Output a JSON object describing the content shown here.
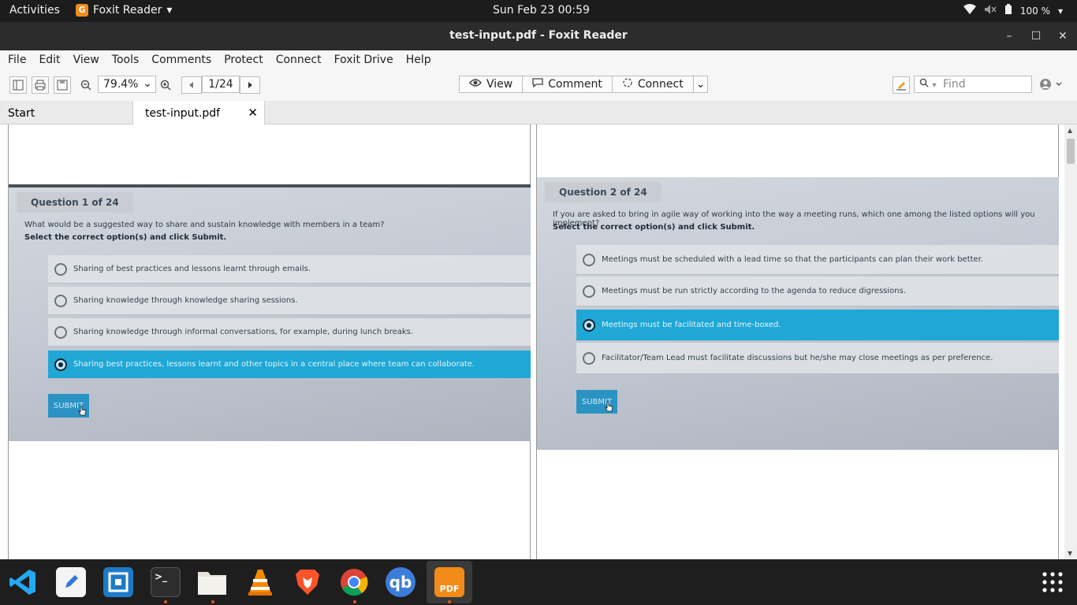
{
  "topbar": {
    "activities": "Activities",
    "app_name": "Foxit Reader",
    "clock": "Sun Feb 23  00:59",
    "battery": "100 %"
  },
  "window": {
    "title": "test-input.pdf - Foxit Reader"
  },
  "menu": [
    "File",
    "Edit",
    "View",
    "Tools",
    "Comments",
    "Protect",
    "Connect",
    "Foxit Drive",
    "Help"
  ],
  "toolbar": {
    "zoom": "79.4%",
    "page": "1/24",
    "view_label": "View",
    "comment_label": "Comment",
    "connect_label": "Connect",
    "find_placeholder": "Find"
  },
  "tabs": {
    "start": "Start",
    "doc": "test-input.pdf"
  },
  "pages": [
    {
      "question_header": "Question 1 of 24",
      "question": "What would be a suggested way to share and sustain knowledge with members in a team?",
      "instruction": "Select the correct option(s) and click Submit.",
      "options": [
        "Sharing of best practices and lessons learnt through emails.",
        "Sharing knowledge through knowledge sharing sessions.",
        "Sharing knowledge through informal conversations, for example, during lunch breaks.",
        "Sharing best practices, lessons learnt and other topics in a central place where team can collaborate."
      ],
      "selected_index": 3,
      "submit": "SUBMIT"
    },
    {
      "question_header": "Question 2 of 24",
      "question": "If you are asked to bring in agile way of working into the way a meeting runs, which one among the listed options will you implement?",
      "instruction": "Select the correct option(s) and click Submit.",
      "options": [
        "Meetings must be scheduled with a lead time so that the participants can plan their work better.",
        "Meetings must be run strictly according to the agenda to reduce digressions.",
        "Meetings must be facilitated and time-boxed.",
        "Facilitator/Team Lead must facilitate discussions but he/she may close meetings as per preference."
      ],
      "selected_index": 2,
      "submit": "SUBMIT"
    }
  ],
  "dock": [
    "vscode-icon",
    "text-editor-icon",
    "remmina-icon",
    "terminal-icon",
    "files-icon",
    "vlc-icon",
    "brave-icon",
    "chrome-icon",
    "qbittorrent-icon",
    "foxit-icon",
    "app-grid-icon"
  ],
  "dock_text": {
    "qbittorrent": "qb",
    "foxit": "PDF"
  },
  "colors": {
    "accent_orange": "#e95420",
    "selection_blue": "#1fa7d6"
  }
}
